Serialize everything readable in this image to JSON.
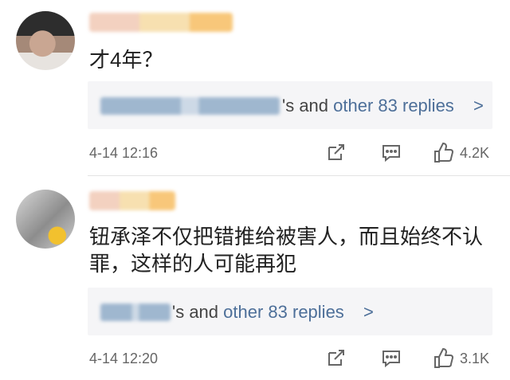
{
  "comments": [
    {
      "text": "才4年？",
      "reply_suffix": "'s and",
      "reply_link": "other 83 replies",
      "reply_chevron": ">",
      "timestamp": "4-14  12:16",
      "likes": "4.2K"
    },
    {
      "text": "钮承泽不仅把错推给被害人，而且始终不认罪，这样的人可能再犯",
      "reply_suffix": "'s and",
      "reply_link": "other 83 replies",
      "reply_chevron": ">",
      "timestamp": "4-14  12:20",
      "likes": "3.1K"
    }
  ],
  "icons": {
    "share": "share-icon",
    "comment": "comment-icon",
    "like": "thumbs-up-icon",
    "chevron": "chevron-right-icon"
  },
  "colors": {
    "link": "#4d6f99",
    "text": "#222222",
    "meta": "#666666",
    "reply_background": "#f5f5f7"
  }
}
